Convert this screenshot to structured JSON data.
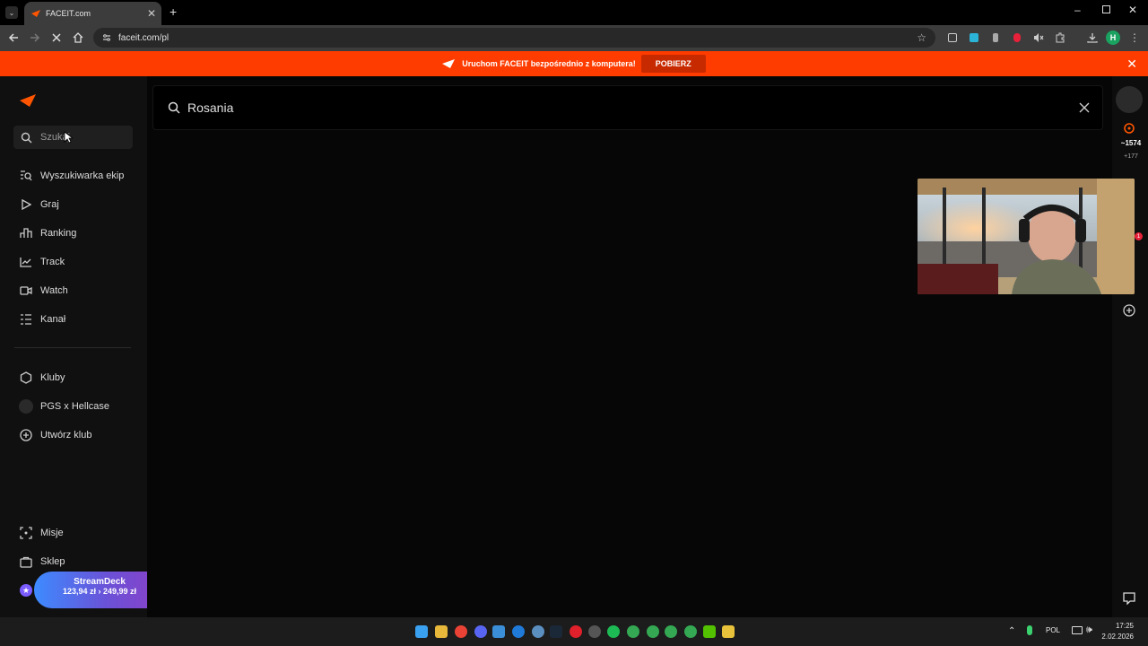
{
  "browser": {
    "tab_title": "FACEIT.com",
    "url": "faceit.com/pl"
  },
  "promo": {
    "text": "Uruchom FACEIT bezpośrednio z komputera!",
    "button": "POBIERZ"
  },
  "sidebar": {
    "search_placeholder": "Szukaj",
    "items": [
      {
        "label": "Wyszukiwarka ekip",
        "icon": "team-search-icon"
      },
      {
        "label": "Graj",
        "icon": "play-icon"
      },
      {
        "label": "Ranking",
        "icon": "ranking-icon"
      },
      {
        "label": "Track",
        "icon": "track-icon"
      },
      {
        "label": "Watch",
        "icon": "watch-icon"
      },
      {
        "label": "Kanał",
        "icon": "feed-icon"
      }
    ],
    "clubs": [
      {
        "label": "Kluby",
        "icon": "clubs-icon"
      },
      {
        "label": "PGS x Hellcase",
        "icon": "club-avatar"
      },
      {
        "label": "Utwórz klub",
        "icon": "add-circle-icon"
      }
    ],
    "bottom": [
      {
        "label": "Misje",
        "icon": "missions-icon"
      },
      {
        "label": "Sklep",
        "icon": "shop-icon"
      }
    ],
    "promo": {
      "title": "StreamDeck",
      "old_price": "123,94 zł",
      "new_price": "249,99 zł"
    }
  },
  "main": {
    "search_value": "Rosania"
  },
  "rail": {
    "elo": "~1574",
    "elo_delta": "+177",
    "badge_count": "1"
  },
  "taskbar": {
    "language": "POL",
    "time": "17:25",
    "date": "2.02.2026"
  },
  "colors": {
    "brand": "#ff5500",
    "promo_bg": "#ff3c00",
    "sidebar_bg": "#101010",
    "main_bg": "#060606"
  }
}
